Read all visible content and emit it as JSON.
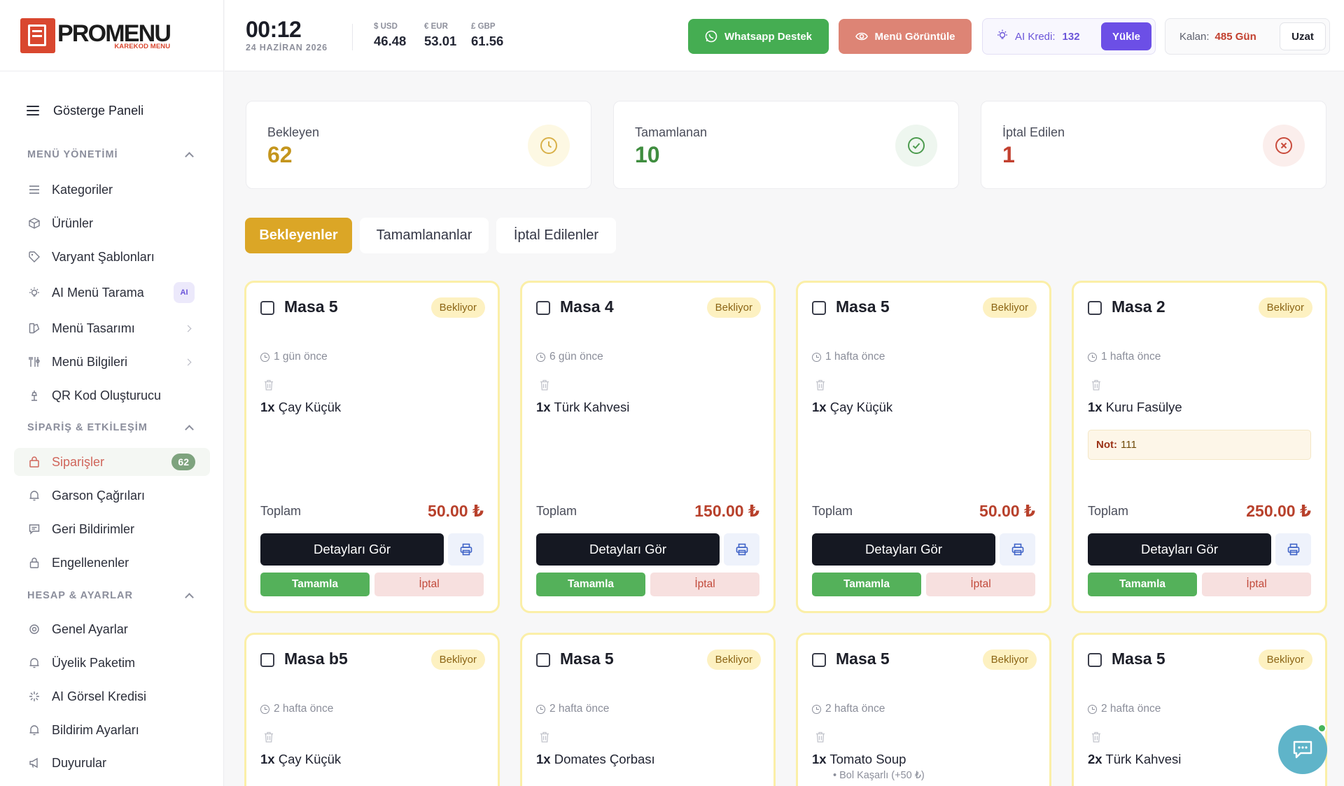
{
  "brand": {
    "name": "PROMENU",
    "tagline": "KAREKOD MENU",
    "color": "#d9472f"
  },
  "header": {
    "time": "00:12",
    "date": "24 HAZİRAN 2026",
    "rates": [
      {
        "label": "$ USD",
        "value": "46.48"
      },
      {
        "label": "€ EUR",
        "value": "53.01"
      },
      {
        "label": "£ GBP",
        "value": "61.56"
      }
    ],
    "whatsapp_label": "Whatsapp Destek",
    "view_menu_label": "Menü Görüntüle",
    "ai_credit_label": "AI Kredi:",
    "ai_credit_value": "132",
    "load_label": "Yükle",
    "remaining_label": "Kalan:",
    "remaining_value": "485 Gün",
    "extend_label": "Uzat"
  },
  "sidebar": {
    "dashboard_label": "Gösterge Paneli",
    "sections": [
      {
        "title": "MENÜ YÖNETİMİ"
      },
      {
        "title": "SİPARİŞ & ETKİLEŞİM"
      },
      {
        "title": "HESAP & AYARLAR"
      }
    ],
    "items": [
      {
        "label": "Kategoriler",
        "icon": "list-icon"
      },
      {
        "label": "Ürünler",
        "icon": "box-icon"
      },
      {
        "label": "Varyant Şablonları",
        "icon": "tag-icon"
      },
      {
        "label": "AI Menü Tarama",
        "icon": "bulb-icon",
        "badge": "AI"
      },
      {
        "label": "Menü Tasarımı",
        "icon": "palette-icon"
      },
      {
        "label": "Menü Bilgileri",
        "icon": "utensils-icon"
      },
      {
        "label": "QR Kod Oluşturucu",
        "icon": "qr-icon"
      },
      {
        "label": "Siparişler",
        "icon": "bag-icon",
        "count": "62",
        "active": true
      },
      {
        "label": "Garson Çağrıları",
        "icon": "bell-icon"
      },
      {
        "label": "Geri Bildirimler",
        "icon": "message-icon"
      },
      {
        "label": "Engellenenler",
        "icon": "lock-icon"
      },
      {
        "label": "Genel Ayarlar",
        "icon": "gear-icon"
      },
      {
        "label": "Üyelik Paketim",
        "icon": "bell-icon"
      },
      {
        "label": "AI Görsel Kredisi",
        "icon": "sparkle-icon"
      },
      {
        "label": "Bildirim Ayarları",
        "icon": "bell-icon"
      },
      {
        "label": "Duyurular",
        "icon": "megaphone-icon"
      }
    ]
  },
  "stats": [
    {
      "label": "Bekleyen",
      "value": "62",
      "color": "#c4951c"
    },
    {
      "label": "Tamamlanan",
      "value": "10",
      "color": "#3f8d3f"
    },
    {
      "label": "İptal Edilen",
      "value": "1",
      "color": "#c2402f"
    }
  ],
  "tabs": [
    {
      "label": "Bekleyenler",
      "active": true
    },
    {
      "label": "Tamamlananlar"
    },
    {
      "label": "İptal Edilenler"
    }
  ],
  "card_labels": {
    "status": "Bekliyor",
    "total": "Toplam",
    "details": "Detayları Gör",
    "complete": "Tamamla",
    "cancel": "İptal",
    "note_prefix": "Not:"
  },
  "orders": [
    {
      "table": "Masa 5",
      "ago": "1 gün önce",
      "qty": "1x",
      "item": "Çay Küçük",
      "total": "50.00 ₺"
    },
    {
      "table": "Masa 4",
      "ago": "6 gün önce",
      "qty": "1x",
      "item": "Türk Kahvesi",
      "total": "150.00 ₺"
    },
    {
      "table": "Masa 5",
      "ago": "1 hafta önce",
      "qty": "1x",
      "item": "Çay Küçük",
      "total": "50.00 ₺"
    },
    {
      "table": "Masa 2",
      "ago": "1 hafta önce",
      "qty": "1x",
      "item": "Kuru Fasülye",
      "total": "250.00 ₺",
      "note": "111"
    },
    {
      "table": "Masa b5",
      "ago": "2 hafta önce",
      "qty": "1x",
      "item": "Çay Küçük"
    },
    {
      "table": "Masa 5",
      "ago": "2 hafta önce",
      "qty": "1x",
      "item": "Domates Çorbası"
    },
    {
      "table": "Masa 5",
      "ago": "2 hafta önce",
      "qty": "1x",
      "item": "Tomato Soup",
      "option": "• Bol Kaşarlı (+50 ₺)"
    },
    {
      "table": "Masa 5",
      "ago": "2 hafta önce",
      "qty": "2x",
      "item": "Türk Kahvesi"
    }
  ]
}
